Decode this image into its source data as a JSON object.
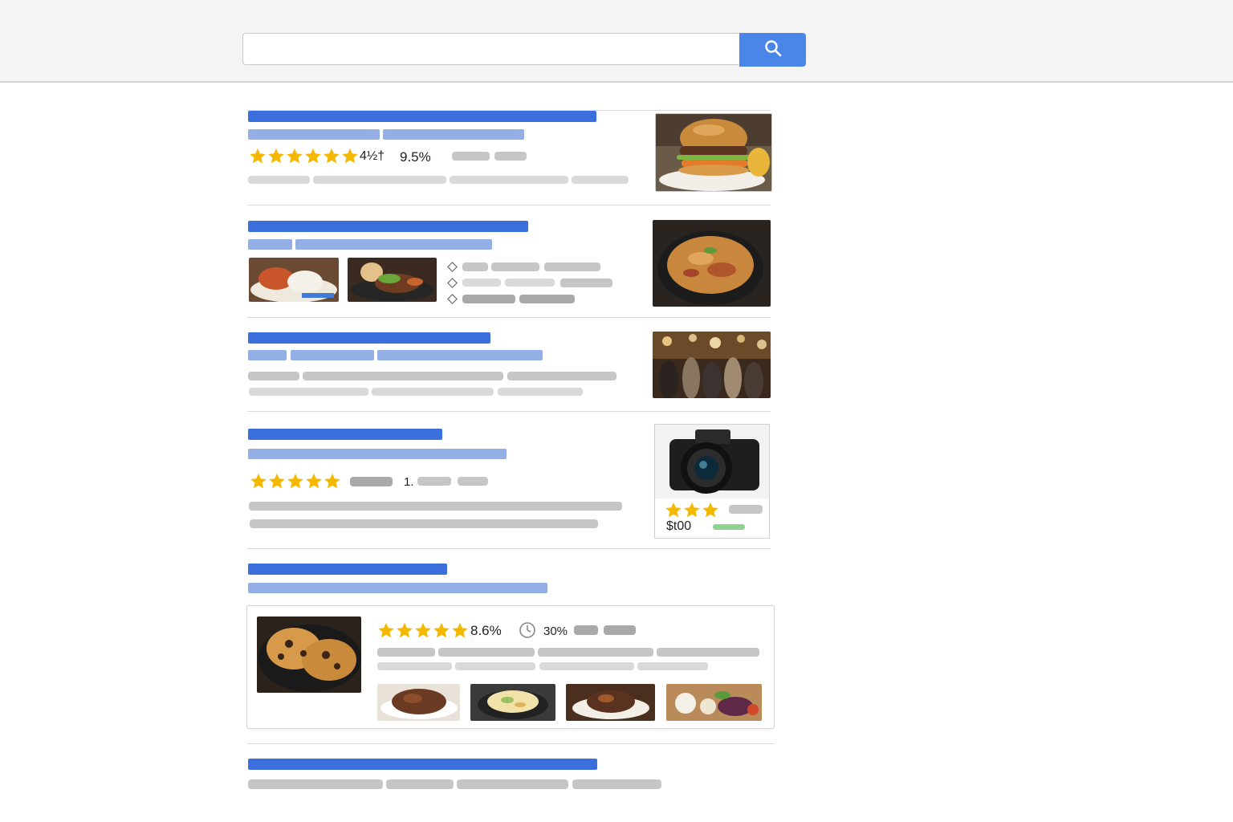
{
  "search": {
    "query": "",
    "placeholder": ""
  },
  "icons": {
    "search_button": "search-icon",
    "clock": "clock-icon",
    "bullet": "diamond-bullet-icon",
    "star": "star-icon"
  },
  "colors": {
    "accent": "#4a86e8",
    "title_bar": "#3b6fdb",
    "url_bar": "#93afe6",
    "star": "#f5b800",
    "price_green": "#8fd18f"
  },
  "results": [
    {
      "id": "result-1",
      "rating_text": "4½†",
      "score_text": "9.5%",
      "thumbnail": "burger-photo"
    },
    {
      "id": "result-2",
      "inline_images": [
        "plated-seafood-photo",
        "grilled-meat-photo"
      ],
      "bullets": 3,
      "thumbnail": "pan-pasta-photo"
    },
    {
      "id": "result-3",
      "thumbnail": "restaurant-crowd-photo"
    },
    {
      "id": "result-4",
      "count_text": "1.",
      "product": {
        "image": "camera-photo",
        "price": "$t00"
      }
    },
    {
      "id": "result-5",
      "card": {
        "main_image": "cookies-photo",
        "score_text": "8.6%",
        "time_text": "30%",
        "gallery": [
          "roast-meat-photo",
          "pasta-salad-photo",
          "stew-photo",
          "vegetables-photo"
        ]
      }
    },
    {
      "id": "result-6"
    }
  ]
}
